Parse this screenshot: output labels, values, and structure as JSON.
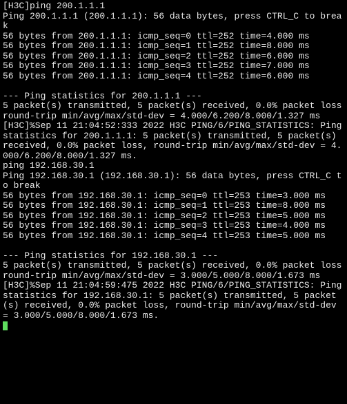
{
  "terminal": {
    "lines": [
      "[H3C]ping 200.1.1.1",
      "Ping 200.1.1.1 (200.1.1.1): 56 data bytes, press CTRL_C to break",
      "56 bytes from 200.1.1.1: icmp_seq=0 ttl=252 time=4.000 ms",
      "56 bytes from 200.1.1.1: icmp_seq=1 ttl=252 time=8.000 ms",
      "56 bytes from 200.1.1.1: icmp_seq=2 ttl=252 time=6.000 ms",
      "56 bytes from 200.1.1.1: icmp_seq=3 ttl=252 time=7.000 ms",
      "56 bytes from 200.1.1.1: icmp_seq=4 ttl=252 time=6.000 ms",
      "",
      "--- Ping statistics for 200.1.1.1 ---",
      "5 packet(s) transmitted, 5 packet(s) received, 0.0% packet loss",
      "round-trip min/avg/max/std-dev = 4.000/6.200/8.000/1.327 ms",
      "[H3C]%Sep 11 21:04:52:333 2022 H3C PING/6/PING_STATISTICS: Ping statistics for 200.1.1.1: 5 packet(s) transmitted, 5 packet(s) received, 0.0% packet loss, round-trip min/avg/max/std-dev = 4.000/6.200/8.000/1.327 ms.",
      "ping 192.168.30.1",
      "Ping 192.168.30.1 (192.168.30.1): 56 data bytes, press CTRL_C to break",
      "56 bytes from 192.168.30.1: icmp_seq=0 ttl=253 time=3.000 ms",
      "56 bytes from 192.168.30.1: icmp_seq=1 ttl=253 time=8.000 ms",
      "56 bytes from 192.168.30.1: icmp_seq=2 ttl=253 time=5.000 ms",
      "56 bytes from 192.168.30.1: icmp_seq=3 ttl=253 time=4.000 ms",
      "56 bytes from 192.168.30.1: icmp_seq=4 ttl=253 time=5.000 ms",
      "",
      "--- Ping statistics for 192.168.30.1 ---",
      "5 packet(s) transmitted, 5 packet(s) received, 0.0% packet loss",
      "round-trip min/avg/max/std-dev = 3.000/5.000/8.000/1.673 ms",
      "[H3C]%Sep 11 21:04:59:475 2022 H3C PING/6/PING_STATISTICS: Ping statistics for 192.168.30.1: 5 packet(s) transmitted, 5 packet(s) received, 0.0% packet loss, round-trip min/avg/max/std-dev = 3.000/5.000/8.000/1.673 ms."
    ]
  }
}
